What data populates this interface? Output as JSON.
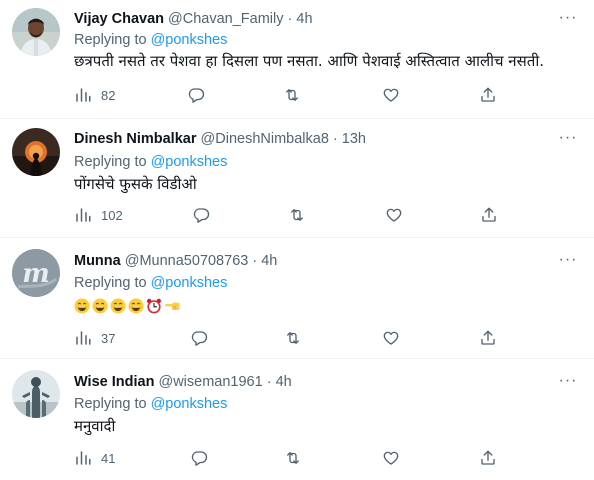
{
  "tweets": [
    {
      "name": "Vijay Chavan",
      "handle": "@Chavan_Family",
      "separator": "·",
      "time": "4h",
      "replying_prefix": "Replying to",
      "replying_to": "@ponkshes",
      "text": "छत्रपती नसते तर पेशवा हा दिसला पण नसता. आणि पेशवाई अस्तित्वात आलीच नसती.",
      "views": "82",
      "more_label": "···"
    },
    {
      "name": "Dinesh Nimbalkar",
      "handle": "@DineshNimbalka8",
      "separator": "·",
      "time": "13h",
      "replying_prefix": "Replying to",
      "replying_to": "@ponkshes",
      "text": "पोंगसेचे फुसके विडीओ",
      "views": "102",
      "more_label": "···"
    },
    {
      "name": "Munna",
      "handle": "@Munna50708763",
      "separator": "·",
      "time": "4h",
      "replying_prefix": "Replying to",
      "replying_to": "@ponkshes",
      "emojis": [
        "grinning-face",
        "grinning-face",
        "grinning-face",
        "grinning-face",
        "alarm-clock",
        "backhand-index-pointing-left"
      ],
      "views": "37",
      "more_label": "···"
    },
    {
      "name": "Wise Indian",
      "handle": "@wiseman1961",
      "separator": "·",
      "time": "4h",
      "replying_prefix": "Replying to",
      "replying_to": "@ponkshes",
      "text": "मनुवादी",
      "views": "41",
      "more_label": "···"
    }
  ],
  "icons": {
    "views": "bar-chart-icon",
    "reply": "speech-bubble-icon",
    "retweet": "retweet-icon",
    "like": "heart-icon",
    "share": "share-upload-icon",
    "more": "ellipsis-icon"
  },
  "colors": {
    "link": "#1d9bf0",
    "secondary_text": "#536471",
    "primary_text": "#0f1419",
    "divider": "#eff3f4"
  }
}
